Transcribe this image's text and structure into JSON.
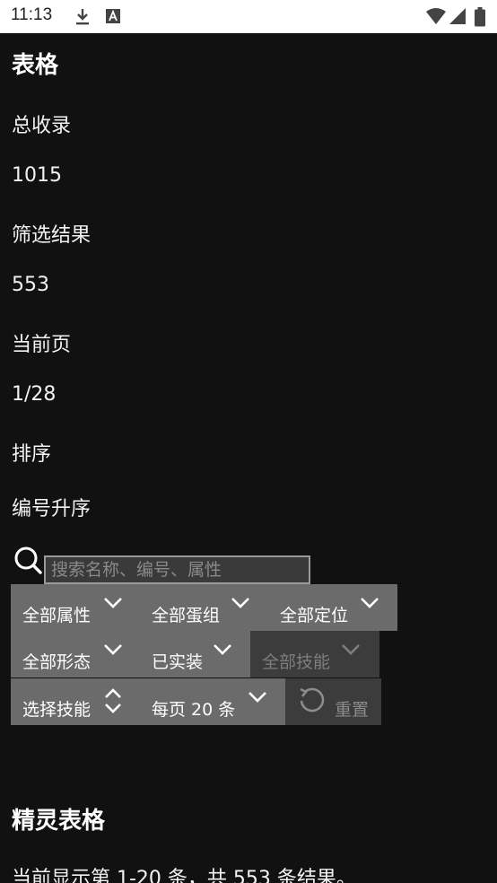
{
  "status_bar": {
    "time": "11:13"
  },
  "page": {
    "title": "表格",
    "stats": [
      {
        "label": "总收录",
        "value": "1015"
      },
      {
        "label": "筛选结果",
        "value": "553"
      },
      {
        "label": "当前页",
        "value": "1/28"
      },
      {
        "label": "排序",
        "value": "编号升序"
      }
    ]
  },
  "search": {
    "placeholder": "搜索名称、编号、属性",
    "value": ""
  },
  "filters": {
    "attribute": "全部属性",
    "egg_group": "全部蛋组",
    "position": "全部定位",
    "form": "全部形态",
    "implemented": "已实装",
    "skill_all": "全部技能",
    "select_skill": "选择技能",
    "per_page": "每页 20 条",
    "reset": "重置"
  },
  "section": {
    "title": "精灵表格",
    "summary": "当前显示第 1-20 条，共 553 条结果。"
  }
}
